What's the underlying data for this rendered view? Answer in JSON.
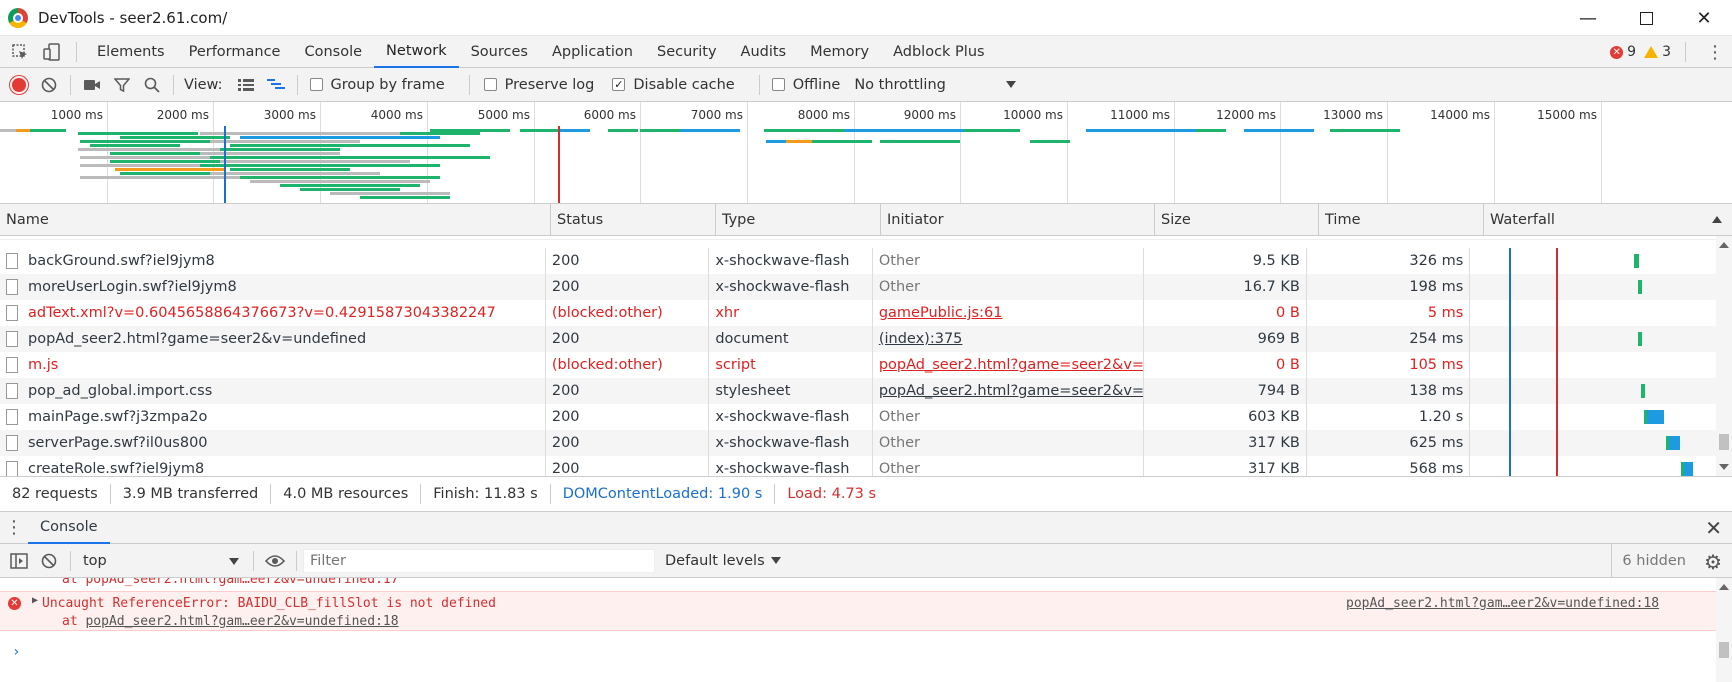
{
  "window": {
    "title": "DevTools - seer2.61.com/"
  },
  "tabs": [
    "Elements",
    "Performance",
    "Console",
    "Network",
    "Sources",
    "Application",
    "Security",
    "Audits",
    "Memory",
    "Adblock Plus"
  ],
  "active_tab": "Network",
  "badges": {
    "errors": "9",
    "warnings": "3"
  },
  "toolbar": {
    "view_label": "View:",
    "group_by_frame": "Group by frame",
    "preserve_log": "Preserve log",
    "disable_cache": "Disable cache",
    "offline": "Offline",
    "throttling": "No throttling"
  },
  "overview": {
    "ticks": [
      "1000 ms",
      "2000 ms",
      "3000 ms",
      "4000 ms",
      "5000 ms",
      "6000 ms",
      "7000 ms",
      "8000 ms",
      "9000 ms",
      "10000 ms",
      "11000 ms",
      "12000 ms",
      "13000 ms",
      "14000 ms",
      "15000 ms"
    ]
  },
  "columns": [
    "Name",
    "Status",
    "Type",
    "Initiator",
    "Size",
    "Time",
    "Waterfall"
  ],
  "rows": [
    {
      "name": "backGround.swf?iel9jym8",
      "status": "200",
      "type": "x-shockwave-flash",
      "initiator": "Other",
      "size": "9.5 KB",
      "time": "326 ms",
      "error": false,
      "init_link": false,
      "wf": [
        {
          "start": 0.88,
          "len": 0.025,
          "color": "#1fb46c"
        }
      ]
    },
    {
      "name": "moreUserLogin.swf?iel9jym8",
      "status": "200",
      "type": "x-shockwave-flash",
      "initiator": "Other",
      "size": "16.7 KB",
      "time": "198 ms",
      "error": false,
      "init_link": false,
      "wf": [
        {
          "start": 0.9,
          "len": 0.012,
          "color": "#1fb46c"
        }
      ]
    },
    {
      "name": "adText.xml?v=0.6045658864376673?v=0.42915873043382247",
      "status": "(blocked:other)",
      "type": "xhr",
      "initiator": "gamePublic.js:61",
      "size": "0 B",
      "time": "5 ms",
      "error": true,
      "init_link": true,
      "wf": []
    },
    {
      "name": "popAd_seer2.html?game=seer2&v=undefined",
      "status": "200",
      "type": "document",
      "initiator": "(index):375",
      "size": "969 B",
      "time": "254 ms",
      "error": false,
      "init_link": true,
      "wf": [
        {
          "start": 0.9,
          "len": 0.015,
          "color": "#1fb46c"
        }
      ]
    },
    {
      "name": "m.js",
      "status": "(blocked:other)",
      "type": "script",
      "initiator": "popAd_seer2.html?game=seer2&v=u...",
      "size": "0 B",
      "time": "105 ms",
      "error": true,
      "init_link": true,
      "wf": []
    },
    {
      "name": "pop_ad_global.import.css",
      "status": "200",
      "type": "stylesheet",
      "initiator": "popAd_seer2.html?game=seer2&v=u...",
      "size": "794 B",
      "time": "138 ms",
      "error": false,
      "init_link": true,
      "wf": [
        {
          "start": 0.915,
          "len": 0.012,
          "color": "#1fb46c"
        }
      ]
    },
    {
      "name": "mainPage.swf?j3zmpa2o",
      "status": "200",
      "type": "x-shockwave-flash",
      "initiator": "Other",
      "size": "603 KB",
      "time": "1.20 s",
      "error": false,
      "init_link": false,
      "wf": [
        {
          "start": 0.93,
          "len": 0.02,
          "color": "#1fb46c"
        },
        {
          "start": 0.95,
          "len": 0.09,
          "color": "#1e9be0"
        }
      ]
    },
    {
      "name": "serverPage.swf?il0us800",
      "status": "200",
      "type": "x-shockwave-flash",
      "initiator": "Other",
      "size": "317 KB",
      "time": "625 ms",
      "error": false,
      "init_link": false,
      "wf": [
        {
          "start": 1.05,
          "len": 0.015,
          "color": "#1fb46c"
        },
        {
          "start": 1.065,
          "len": 0.06,
          "color": "#1e9be0"
        }
      ]
    },
    {
      "name": "createRole.swf?iel9jym8",
      "status": "200",
      "type": "x-shockwave-flash",
      "initiator": "Other",
      "size": "317 KB",
      "time": "568 ms",
      "error": false,
      "init_link": false,
      "wf": [
        {
          "start": 1.13,
          "len": 0.015,
          "color": "#1fb46c"
        },
        {
          "start": 1.145,
          "len": 0.05,
          "color": "#1e9be0"
        }
      ]
    }
  ],
  "status": {
    "requests": "82 requests",
    "transferred": "3.9 MB transferred",
    "resources": "4.0 MB resources",
    "finish": "Finish: 11.83 s",
    "dcl": "DOMContentLoaded: 1.90 s",
    "load": "Load: 4.73 s"
  },
  "drawer": {
    "tab": "Console"
  },
  "console_toolbar": {
    "context": "top",
    "filter_placeholder": "Filter",
    "levels": "Default levels",
    "hidden": "6 hidden"
  },
  "console": {
    "truncated_line": "at popAd_seer2.html?gam…eer2&v=undefined:17",
    "error_message": "Uncaught ReferenceError: BAIDU_CLB_fillSlot is not defined",
    "error_at_prefix": "at ",
    "error_at_link": "popAd_seer2.html?gam…eer2&v=undefined:18",
    "error_source": "popAd_seer2.html?gam…eer2&v=undefined:18"
  },
  "colors": {
    "accent": "#1a73e8",
    "error": "#e02020",
    "green": "#1fb46c",
    "blue": "#1e9be0"
  }
}
